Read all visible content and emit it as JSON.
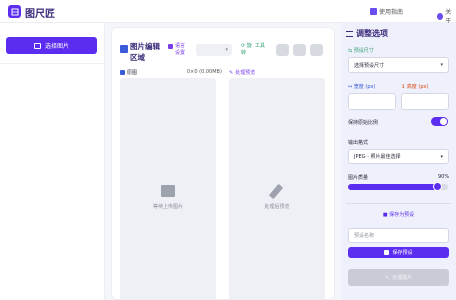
{
  "header": {
    "app_title": "图尺匠",
    "nav_guide": "使用指南",
    "nav_about": "关于"
  },
  "sidebar": {
    "select_image_label": "选择图片"
  },
  "editor": {
    "title": "图片编辑区域",
    "language_label": "语言设置",
    "rotate_label": "旋转",
    "tools_label": "工具",
    "original_label": "原图",
    "original_size": "0×0 (0.00MB)",
    "preview_label": "处理预览",
    "upload_placeholder": "等待上传图片",
    "preview_placeholder": "处理后预览"
  },
  "settings": {
    "title": "调整选项",
    "preset_size_label": "预设尺寸",
    "preset_size_value": "选择预设尺寸",
    "width_label": "宽度 (px)",
    "height_label": "高度 (px)",
    "width_value": "",
    "height_value": "",
    "keep_ratio_label": "保持原始比例",
    "keep_ratio_on": true,
    "output_format_label": "输出格式",
    "output_format_value": "JPEG - 照片最佳选择",
    "quality_label": "图片质量",
    "quality_value_text": "90%",
    "quality_value": 0.9,
    "save_preset_title": "保存为预设",
    "preset_name_placeholder": "预设名称",
    "save_preset_button": "保存预设",
    "apply_button": "处理图片"
  },
  "colors": {
    "accent": "#5b2df0",
    "title": "#3b2b7a",
    "green": "#2f9e6e",
    "blue": "#3b5bdb",
    "red": "#d9480f",
    "panel_bg": "#eef0fb"
  }
}
